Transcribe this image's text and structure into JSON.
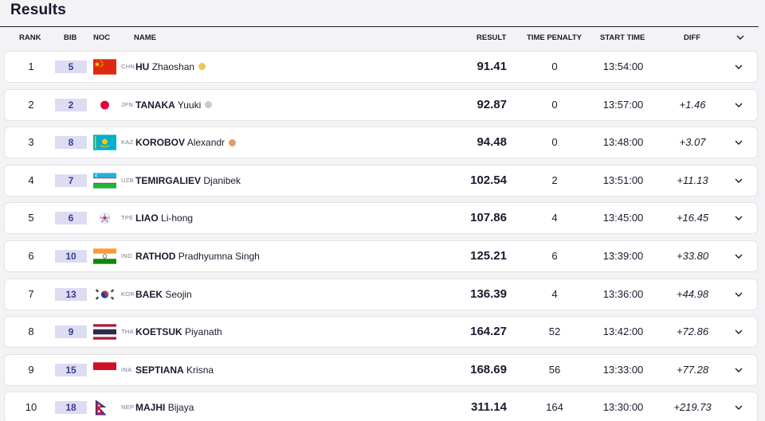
{
  "title": "Results",
  "columns": {
    "rank": "RANK",
    "bib": "BIB",
    "noc": "NOC",
    "name": "NAME",
    "result": "RESULT",
    "penalty": "TIME PENALTY",
    "start": "START TIME",
    "diff": "DIFF"
  },
  "medal_colors": {
    "gold": "#e8c95a",
    "silver": "#c9c9cf",
    "bronze": "#e39a6c"
  },
  "rows": [
    {
      "rank": "1",
      "bib": "5",
      "noc": "CHN",
      "last": "HU",
      "first": "Zhaoshan",
      "medal": "gold",
      "result": "91.41",
      "penalty": "0",
      "start": "13:54:00",
      "diff": ""
    },
    {
      "rank": "2",
      "bib": "2",
      "noc": "JPN",
      "last": "TANAKA",
      "first": "Yuuki",
      "medal": "silver",
      "result": "92.87",
      "penalty": "0",
      "start": "13:57:00",
      "diff": "+1.46"
    },
    {
      "rank": "3",
      "bib": "8",
      "noc": "KAZ",
      "last": "KOROBOV",
      "first": "Alexandr",
      "medal": "bronze",
      "result": "94.48",
      "penalty": "0",
      "start": "13:48:00",
      "diff": "+3.07"
    },
    {
      "rank": "4",
      "bib": "7",
      "noc": "UZB",
      "last": "TEMIRGALIEV",
      "first": "Djanibek",
      "medal": "",
      "result": "102.54",
      "penalty": "2",
      "start": "13:51:00",
      "diff": "+11.13"
    },
    {
      "rank": "5",
      "bib": "6",
      "noc": "TPE",
      "last": "LIAO",
      "first": "Li-hong",
      "medal": "",
      "result": "107.86",
      "penalty": "4",
      "start": "13:45:00",
      "diff": "+16.45"
    },
    {
      "rank": "6",
      "bib": "10",
      "noc": "IND",
      "last": "RATHOD",
      "first": "Pradhyumna Singh",
      "medal": "",
      "result": "125.21",
      "penalty": "6",
      "start": "13:39:00",
      "diff": "+33.80"
    },
    {
      "rank": "7",
      "bib": "13",
      "noc": "KOR",
      "last": "BAEK",
      "first": "Seojin",
      "medal": "",
      "result": "136.39",
      "penalty": "4",
      "start": "13:36:00",
      "diff": "+44.98"
    },
    {
      "rank": "8",
      "bib": "9",
      "noc": "THA",
      "last": "KOETSUK",
      "first": "Piyanath",
      "medal": "",
      "result": "164.27",
      "penalty": "52",
      "start": "13:42:00",
      "diff": "+72.86"
    },
    {
      "rank": "9",
      "bib": "15",
      "noc": "INA",
      "last": "SEPTIANA",
      "first": "Krisna",
      "medal": "",
      "result": "168.69",
      "penalty": "56",
      "start": "13:33:00",
      "diff": "+77.28"
    },
    {
      "rank": "10",
      "bib": "18",
      "noc": "NEP",
      "last": "MAJHI",
      "first": "Bijaya",
      "medal": "",
      "result": "311.14",
      "penalty": "164",
      "start": "13:30:00",
      "diff": "+219.73"
    }
  ]
}
